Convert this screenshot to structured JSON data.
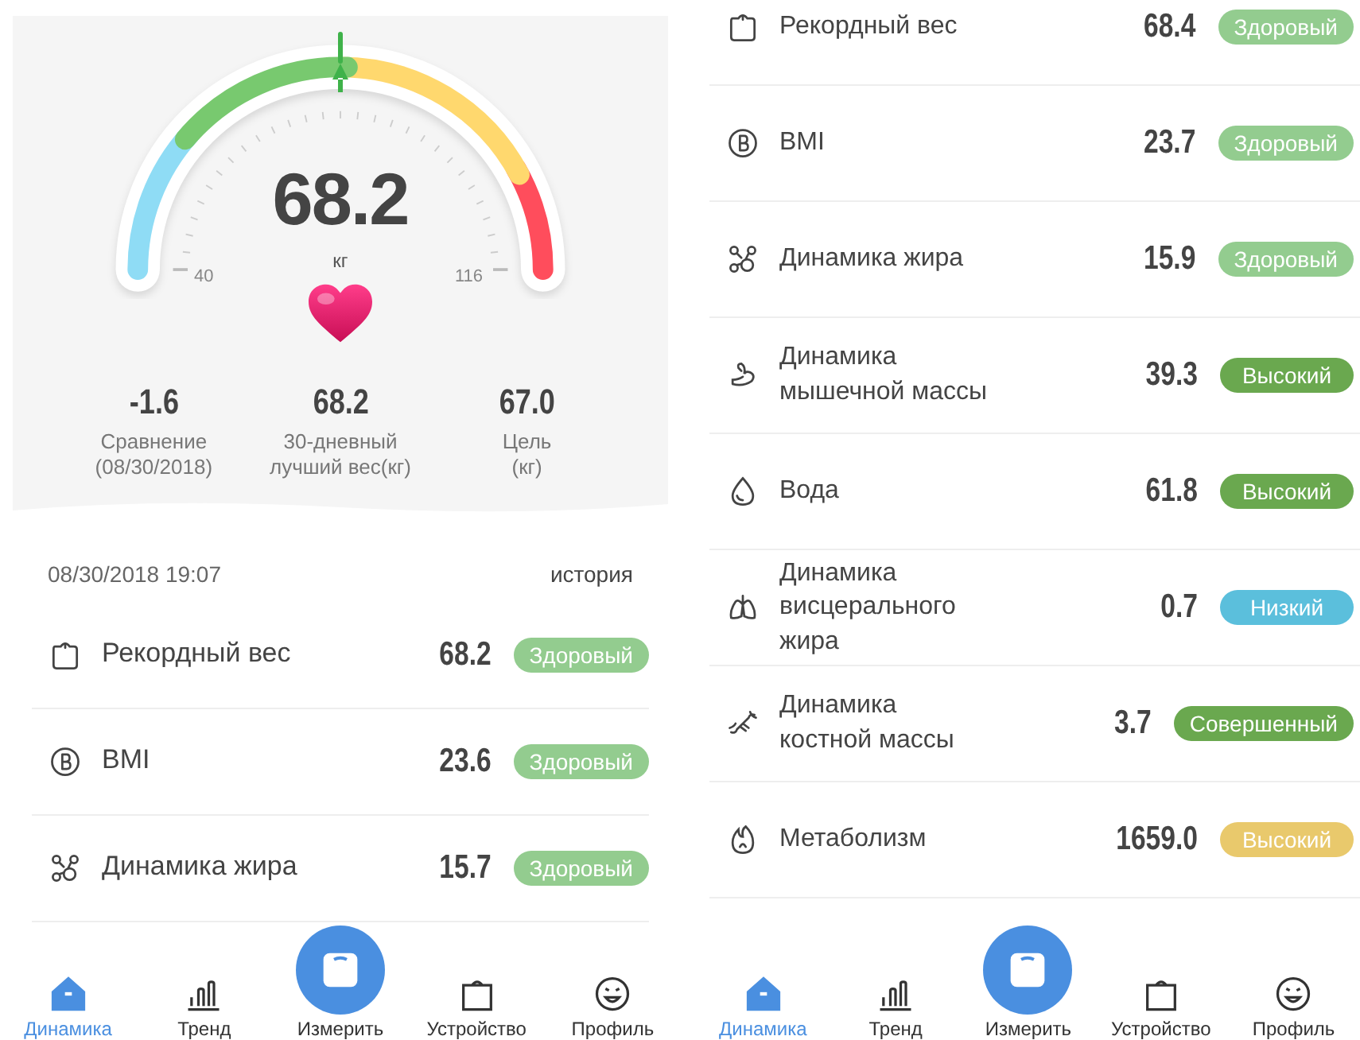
{
  "screens": [
    {
      "gauge": {
        "value": "68.2",
        "unit": "кг",
        "min_label": "40",
        "max_label": "116",
        "level": 0.5
      },
      "stats": [
        {
          "value": "-1.6",
          "label": "Сравнение\n(08/30/2018)"
        },
        {
          "value": "68.2",
          "label": "30-дневный\nлучший вес(кг)"
        },
        {
          "value": "67.0",
          "label": "Цель\n(кг)"
        }
      ],
      "date": "08/30/2018 19:07",
      "history_link": "история",
      "metrics": [
        {
          "kind": "scale",
          "label": "Рекордный вес",
          "value": "68.2",
          "status": "Здоровый",
          "color": "#93cc8f"
        },
        {
          "kind": "bmi",
          "label": "BMI",
          "value": "23.6",
          "status": "Здоровый",
          "color": "#93cc8f"
        },
        {
          "kind": "fat",
          "label": "Динамика жира",
          "value": "15.7",
          "status": "Здоровый",
          "color": "#93cc8f"
        }
      ],
      "nav": [
        {
          "kind": "home",
          "label": "Динамика",
          "selected": true
        },
        {
          "kind": "trend",
          "label": "Тренд",
          "selected": false
        },
        {
          "kind": "measure",
          "label": "Измерить",
          "selected": false
        },
        {
          "kind": "device",
          "label": "Устройство",
          "selected": false
        },
        {
          "kind": "profile",
          "label": "Профиль",
          "selected": false
        }
      ]
    },
    {
      "metrics": [
        {
          "kind": "scale",
          "label": "Рекордный вес",
          "value": "68.4",
          "status": "Здоровый",
          "color": "#93cc8f"
        },
        {
          "kind": "bmi",
          "label": "BMI",
          "value": "23.7",
          "status": "Здоровый",
          "color": "#93cc8f"
        },
        {
          "kind": "fat",
          "label": "Динамика жира",
          "value": "15.9",
          "status": "Здоровый",
          "color": "#93cc8f"
        },
        {
          "kind": "muscle",
          "label": "Динамика мышечной массы",
          "value": "39.3",
          "status": "Высокий",
          "color": "#6aa84f"
        },
        {
          "kind": "water",
          "label": "Вода",
          "value": "61.8",
          "status": "Высокий",
          "color": "#6aa84f"
        },
        {
          "kind": "visceral",
          "label": "Динамика висцерального жира",
          "value": "0.7",
          "status": "Низкий",
          "color": "#5bbfdc"
        },
        {
          "kind": "bone",
          "label": "Динамика костной массы",
          "value": "3.7",
          "status": "Совершенный",
          "color": "#6aa84f"
        },
        {
          "kind": "metabolism",
          "label": "Метаболизм",
          "value": "1659.0",
          "status": "Высокий",
          "color": "#e9c96c"
        }
      ],
      "nav": [
        {
          "kind": "home",
          "label": "Динамика",
          "selected": true
        },
        {
          "kind": "trend",
          "label": "Тренд",
          "selected": false
        },
        {
          "kind": "measure",
          "label": "Измерить",
          "selected": false
        },
        {
          "kind": "device",
          "label": "Устройство",
          "selected": false
        },
        {
          "kind": "profile",
          "label": "Профиль",
          "selected": false
        }
      ]
    }
  ]
}
